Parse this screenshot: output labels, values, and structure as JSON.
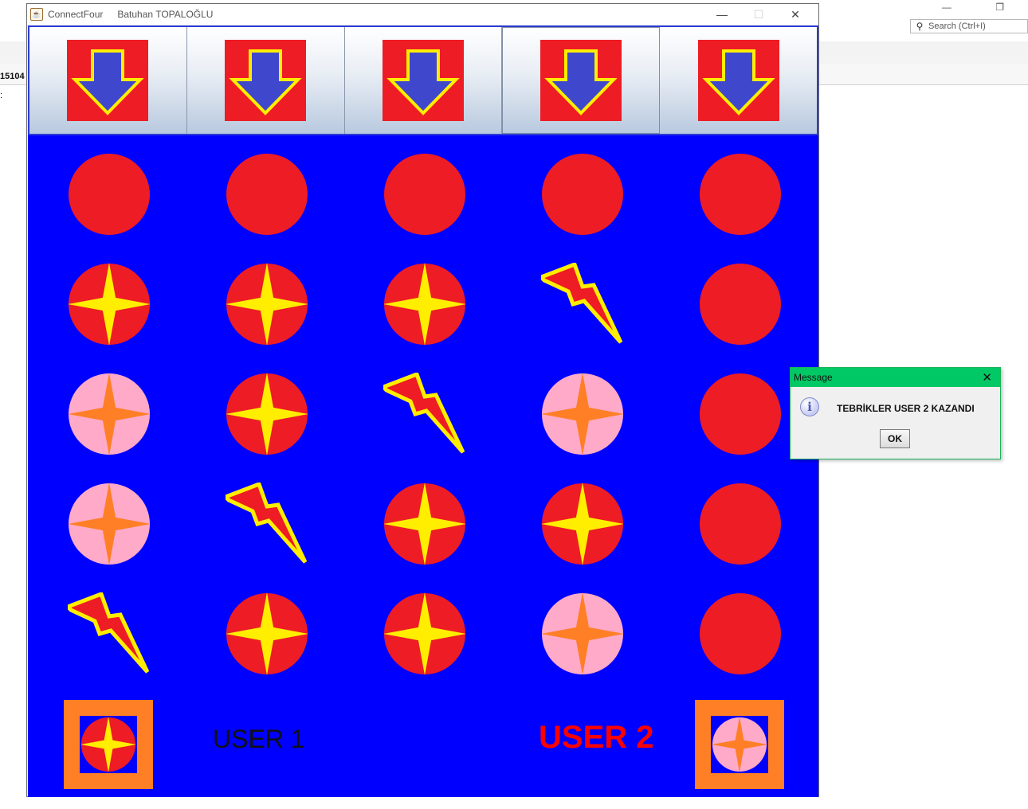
{
  "background": {
    "search_placeholder": "Search (Ctrl+I)",
    "left_text_1": "15104",
    "left_text_2": ":",
    "window_controls": "— ❐"
  },
  "window": {
    "title_app": "ConnectFour",
    "title_author": "Batuhan TOPALOĞLU",
    "minimize": "—",
    "maximize": "☐",
    "close": "✕"
  },
  "board": {
    "columns": 5,
    "drop_buttons": [
      "drop",
      "drop",
      "drop",
      "drop",
      "drop"
    ],
    "focused_button": 3,
    "grid": [
      [
        "empty",
        "empty",
        "empty",
        "empty",
        "empty"
      ],
      [
        "user1",
        "user1",
        "user1",
        "win",
        "empty"
      ],
      [
        "user2",
        "user1",
        "win",
        "user2",
        "empty"
      ],
      [
        "user2",
        "win",
        "user1",
        "user1",
        "empty"
      ],
      [
        "win",
        "user1",
        "user1",
        "user2",
        "empty"
      ]
    ],
    "colors": {
      "board": "#0000ff",
      "empty": "#ee1c24",
      "user1_disc": "#ee1c24",
      "user1_star": "#ffee00",
      "user2_disc": "#ffaac8",
      "user2_star": "#ff7f27",
      "win_fill": "#ee1c24",
      "win_stroke": "#ffee00",
      "arrow_bg": "#ee1c24",
      "arrow_fill": "#3f48cc",
      "arrow_stroke": "#ffee00",
      "indicator_frame": "#ff7f27"
    }
  },
  "players": {
    "user1_label": "USER 1",
    "user2_label": "USER 2",
    "active": "user2"
  },
  "dialog": {
    "title": "Message",
    "close": "✕",
    "icon": "info-icon",
    "message": "TEBRİKLER USER 2 KAZANDI",
    "ok_label": "OK"
  }
}
